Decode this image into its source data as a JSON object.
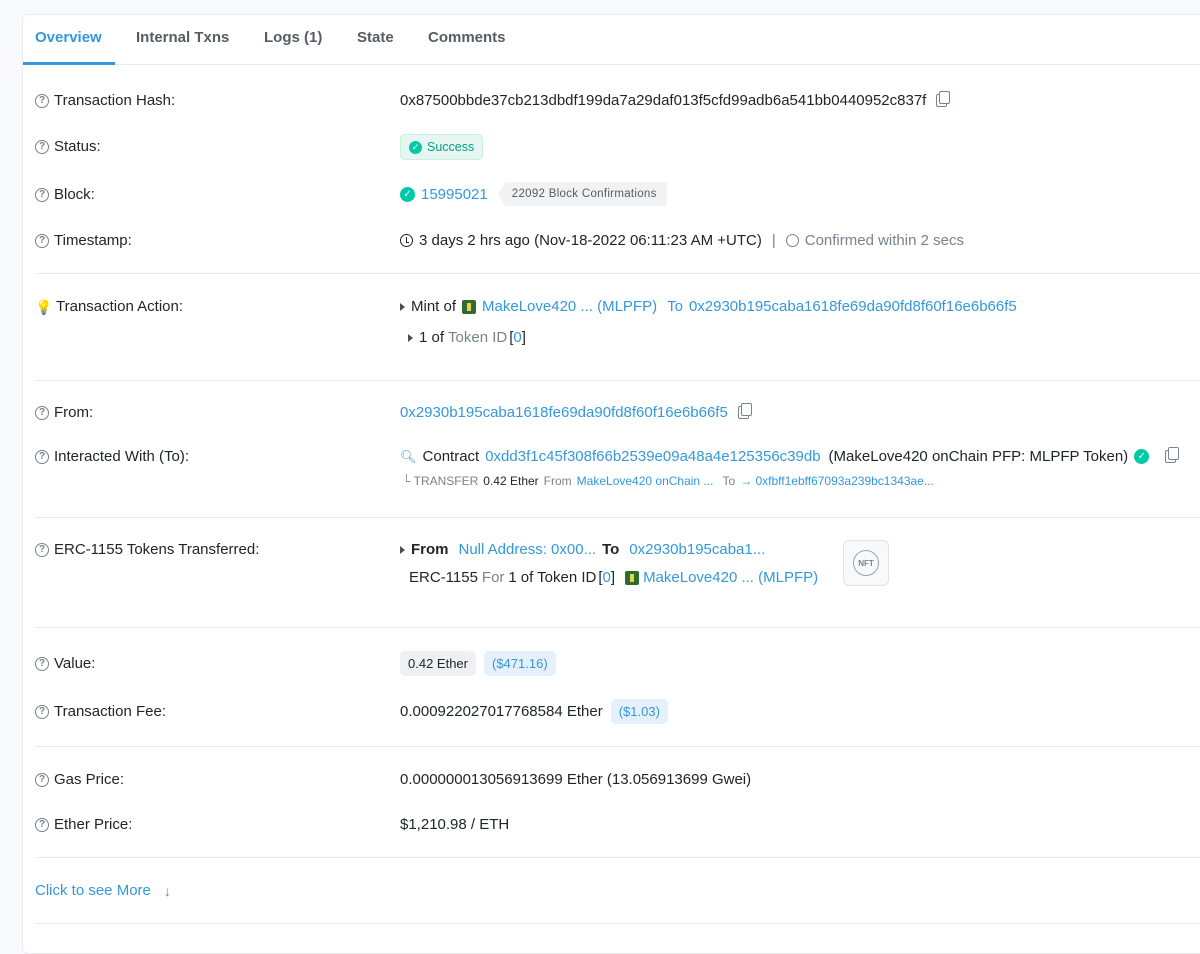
{
  "tabs": [
    {
      "label": "Overview"
    },
    {
      "label": "Internal Txns"
    },
    {
      "label": "Logs (1)"
    },
    {
      "label": "State"
    },
    {
      "label": "Comments"
    }
  ],
  "tx_hash": {
    "label": "Transaction Hash:",
    "value": "0x87500bbde37cb213dbdf199da7a29daf013f5cfd99adb6a541bb0440952c837f"
  },
  "status": {
    "label": "Status:",
    "value": "Success"
  },
  "block": {
    "label": "Block:",
    "number": "15995021",
    "confirmations": "22092 Block Confirmations"
  },
  "timestamp": {
    "label": "Timestamp:",
    "value": "3 days 2 hrs ago (Nov-18-2022 06:11:23 AM +UTC)",
    "separator": "|",
    "confirmed": "Confirmed within 2 secs"
  },
  "action": {
    "label": "Transaction Action:",
    "mint_prefix": "Mint of",
    "token_name": "MakeLove420 ... (MLPFP)",
    "to_word": "To",
    "to_address": "0x2930b195caba1618fe69da90fd8f60f16e6b66f5",
    "sub_count": "1 of",
    "sub_token": "Token ID",
    "sub_bracket_open": "[",
    "sub_id": "0",
    "sub_bracket_close": "]"
  },
  "from": {
    "label": "From:",
    "value": "0x2930b195caba1618fe69da90fd8f60f16e6b66f5"
  },
  "interacted": {
    "label": "Interacted With (To):",
    "contract_word": "Contract",
    "contract_address": "0xdd3f1c45f308f66b2539e09a48a4e125356c39db",
    "contract_name": "(MakeLove420 onChain PFP: MLPFP Token)",
    "transfer_label": "└ TRANSFER",
    "transfer_amount": "0.42 Ether",
    "transfer_from_word": "From",
    "transfer_from": "MakeLove420 onChain ...",
    "transfer_to_word": "To",
    "transfer_to": "→ 0xfbff1ebff67093a239bc1343ae..."
  },
  "erc1155": {
    "label": "ERC-1155 Tokens Transferred:",
    "from_word": "From",
    "from_value": "Null Address: 0x00...",
    "to_word": "To",
    "to_value": "0x2930b195caba1...",
    "standard": "ERC-1155",
    "for_word": "For",
    "count": "1",
    "of_token": "of Token ID",
    "bracket_open": "[",
    "token_id": "0",
    "bracket_close": "]",
    "token_name": "MakeLove420 ... (MLPFP)",
    "nft_badge": "NFT"
  },
  "value": {
    "label": "Value:",
    "ether": "0.42 Ether",
    "usd": "($471.16)"
  },
  "fee": {
    "label": "Transaction Fee:",
    "ether": "0.000922027017768584 Ether",
    "usd": "($1.03)"
  },
  "gas": {
    "label": "Gas Price:",
    "value": "0.000000013056913699 Ether (13.056913699 Gwei)"
  },
  "ether_price": {
    "label": "Ether Price:",
    "value": "$1,210.98 / ETH"
  },
  "more": {
    "label": "Click to see More"
  },
  "colors": {
    "accent": "#3498db",
    "success": "#00c9a7"
  }
}
